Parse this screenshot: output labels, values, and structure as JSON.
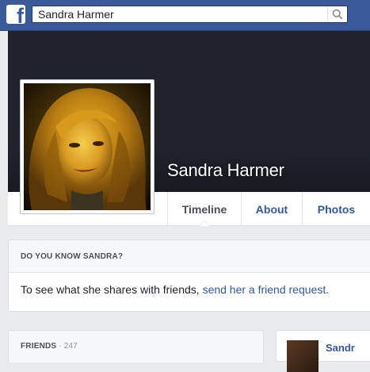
{
  "topbar": {
    "logo_letter": "f",
    "search_value": "Sandra Harmer",
    "accent_color": "#3b5998"
  },
  "profile": {
    "name": "Sandra Harmer"
  },
  "tabs": [
    {
      "label": "Timeline",
      "active": true
    },
    {
      "label": "About",
      "active": false
    },
    {
      "label": "Photos",
      "active": false
    }
  ],
  "know_card": {
    "title": "DO YOU KNOW SANDRA?",
    "body_text": "To see what she shares with friends, ",
    "link_text": "send her a friend request."
  },
  "friends_card": {
    "title": "FRIENDS",
    "count": " · 247"
  },
  "side_card": {
    "name": "Sandr"
  }
}
